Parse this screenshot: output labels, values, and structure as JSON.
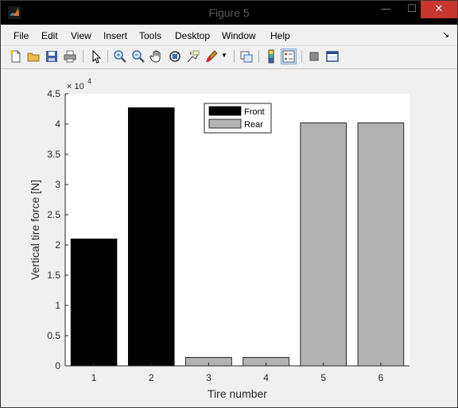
{
  "window": {
    "title": "Figure 5",
    "minimize_glyph": "—",
    "maximize_glyph": "☐",
    "close_glyph": "✕"
  },
  "menu": {
    "items": [
      "File",
      "Edit",
      "View",
      "Insert",
      "Tools",
      "Desktop",
      "Window",
      "Help"
    ],
    "dock_arrow": "↘"
  },
  "toolbar": {
    "tools": [
      "new-figure",
      "open-file",
      "save",
      "print",
      "select-arrow",
      "zoom-in",
      "zoom-out",
      "pan",
      "rotate-3d",
      "data-cursor",
      "brush",
      "link-plot",
      "colorbar",
      "legend",
      "hide-plot-tools",
      "show-plot-tools"
    ],
    "pressed": [
      "legend"
    ]
  },
  "colors": {
    "front": "#000000",
    "rear": "#b3b3b3",
    "axes_bg": "#ffffff",
    "figure_bg": "#f0f0f0",
    "close_red": "#c7372f"
  },
  "chart_data": {
    "type": "bar",
    "categories": [
      "1",
      "2",
      "3",
      "4",
      "5",
      "6"
    ],
    "series": [
      {
        "name": "Front",
        "values": [
          21000,
          42700,
          null,
          null,
          null,
          null
        ],
        "color": "#000000"
      },
      {
        "name": "Rear",
        "values": [
          null,
          null,
          1400,
          1400,
          40200,
          40200
        ],
        "color": "#b3b3b3"
      }
    ],
    "xlabel": "Tire number",
    "ylabel": "Vertical tire force [N]",
    "ylim": [
      0,
      45000
    ],
    "yticks": [
      0,
      5000,
      10000,
      15000,
      20000,
      25000,
      30000,
      35000,
      40000,
      45000
    ],
    "ytick_labels": [
      "0",
      "0.5",
      "1",
      "1.5",
      "2",
      "2.5",
      "3",
      "3.5",
      "4",
      "4.5"
    ],
    "exponent_label": "× 10",
    "exponent": "4",
    "legend_position": "top-center",
    "grid": false
  }
}
